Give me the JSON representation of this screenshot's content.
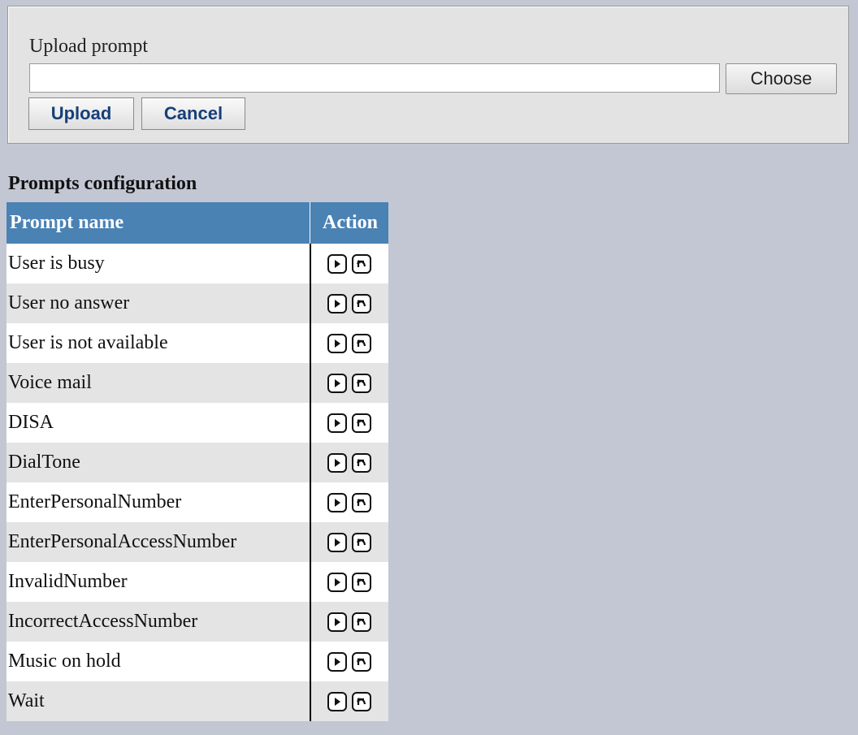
{
  "upload": {
    "label": "Upload prompt",
    "file_value": "",
    "choose_label": "Choose",
    "upload_label": "Upload",
    "cancel_label": "Cancel"
  },
  "section_title": "Prompts configuration",
  "table": {
    "headers": [
      "Prompt name",
      "Action"
    ],
    "rows": [
      {
        "name": "User is busy"
      },
      {
        "name": "User no answer"
      },
      {
        "name": "User is not available"
      },
      {
        "name": "Voice mail"
      },
      {
        "name": "DISA"
      },
      {
        "name": "DialTone"
      },
      {
        "name": "EnterPersonalNumber"
      },
      {
        "name": "EnterPersonalAccessNumber"
      },
      {
        "name": "InvalidNumber"
      },
      {
        "name": "IncorrectAccessNumber"
      },
      {
        "name": "Music on hold"
      },
      {
        "name": "Wait"
      }
    ],
    "row_icons": [
      "play-icon",
      "reset-icon"
    ]
  },
  "colors": {
    "page_background": "#c3c7d3",
    "header_background": "#4a82b4",
    "button_text": "#163f7a"
  }
}
